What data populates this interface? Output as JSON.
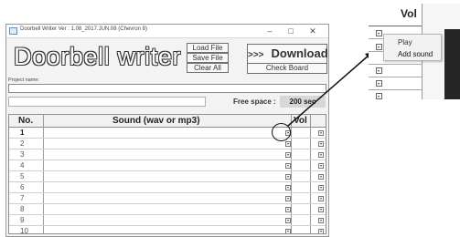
{
  "window": {
    "title": "Doorbell Writer Ver : 1.08_2017.JUN.08 (Chevron 8)",
    "controls": {
      "minimize": "–",
      "maximize": "□",
      "close": "✕"
    }
  },
  "logo": "Doorbell writer",
  "buttons": {
    "load_file": "Load File",
    "save_file": "Save File",
    "clear_all": "Clear All",
    "download_arrow": ">>>",
    "download": "Download",
    "check_board": "Check Board"
  },
  "project": {
    "label": "Project name:",
    "value": "",
    "sub_value": ""
  },
  "free_space": {
    "label": "Free space :",
    "value": "200 sec"
  },
  "table": {
    "headers": {
      "no": "No.",
      "sound": "Sound (wav or mp3)",
      "vol": "Vol"
    },
    "rows": [
      "1",
      "2",
      "3",
      "4",
      "5",
      "6",
      "7",
      "8",
      "9",
      "10"
    ]
  },
  "zoom": {
    "vol_header": "Vol",
    "menu_items": [
      "Play",
      "Add sound"
    ],
    "highlighted_item": "Add sound"
  },
  "icons": {
    "app": "app-icon",
    "dropdown": "dropdown-arrow-icon",
    "callout": "callout-arrow-icon"
  },
  "colors": {
    "logo_fill": "#ffffff",
    "logo_outline": "#333333",
    "free_space_bg": "#d7d7d7"
  }
}
